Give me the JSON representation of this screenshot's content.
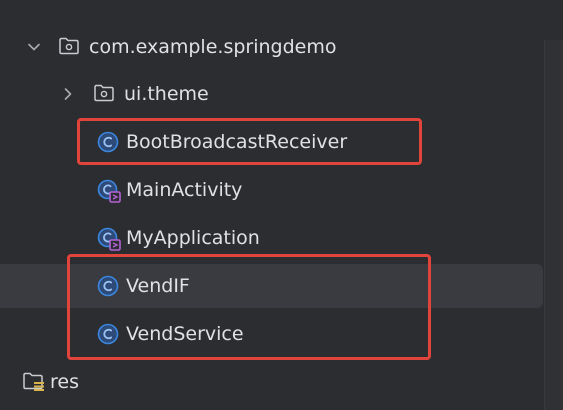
{
  "tree": {
    "items": [
      {
        "label": "com.example.springdemo",
        "kind": "package",
        "expanded": true
      },
      {
        "label": "ui.theme",
        "kind": "package",
        "expanded": false
      },
      {
        "label": "BootBroadcastReceiver",
        "kind": "class"
      },
      {
        "label": "MainActivity",
        "kind": "activity"
      },
      {
        "label": "MyApplication",
        "kind": "activity"
      },
      {
        "label": "VendIF",
        "kind": "class"
      },
      {
        "label": "VendService",
        "kind": "class"
      },
      {
        "label": "res",
        "kind": "resource-folder"
      }
    ]
  },
  "colors": {
    "background": "#2b2d30",
    "selection": "#393b40",
    "highlight_box": "#e0443a",
    "class_icon": "#3b87e0",
    "activity_badge": "#b462d6",
    "text": "#dfe1e5"
  },
  "icons": {
    "expanded": "chevron-down-icon",
    "collapsed": "chevron-right-icon",
    "package": "package-folder-icon",
    "class": "class-c-icon",
    "activity": "activity-class-icon",
    "resources": "resources-folder-icon"
  }
}
